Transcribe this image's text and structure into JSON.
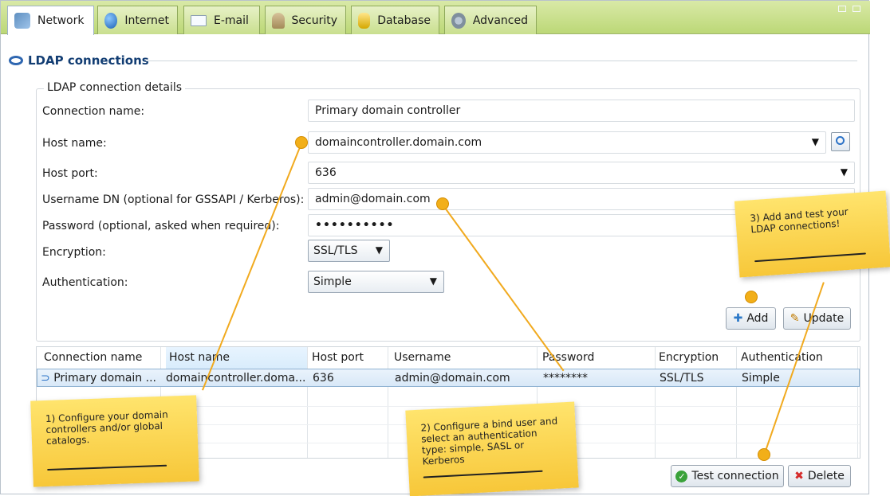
{
  "tabs": [
    {
      "label": "Network",
      "icon": "network-icon",
      "active": true
    },
    {
      "label": "Internet",
      "icon": "globe-icon",
      "active": false
    },
    {
      "label": "E-mail",
      "icon": "email-icon",
      "active": false
    },
    {
      "label": "Security",
      "icon": "security-icon",
      "active": false
    },
    {
      "label": "Database",
      "icon": "database-icon",
      "active": false
    },
    {
      "label": "Advanced",
      "icon": "gear-icon",
      "active": false
    }
  ],
  "section": {
    "title": "LDAP connections",
    "group_title": "LDAP connection details"
  },
  "form": {
    "connection_name": {
      "label": "Connection name:",
      "value": "Primary domain controller"
    },
    "host_name": {
      "label": "Host name:",
      "value": "domaincontroller.domain.com"
    },
    "host_port": {
      "label": "Host port:",
      "value": "636"
    },
    "username_dn": {
      "label": "Username DN (optional for GSSAPI / Kerberos):",
      "value": "admin@domain.com"
    },
    "password": {
      "label": "Password (optional, asked when required):",
      "value": "••••••••••"
    },
    "encryption": {
      "label": "Encryption:",
      "value": "SSL/TLS"
    },
    "authentication": {
      "label": "Authentication:",
      "value": "Simple"
    }
  },
  "buttons": {
    "add": "Add",
    "update": "Update",
    "test_connection": "Test connection",
    "delete": "Delete"
  },
  "table": {
    "headers": [
      "Connection name",
      "Host name",
      "Host port",
      "Username",
      "Password",
      "Encryption",
      "Authentication"
    ],
    "rows": [
      [
        "Primary domain ...",
        "domaincontroller.doma...",
        "636",
        "admin@domain.com",
        "********",
        "SSL/TLS",
        "Simple"
      ]
    ]
  },
  "notes": {
    "note1": "1) Configure your domain controllers and/or global catalogs.",
    "note2": "2) Configure a bind user and select an authentication type: simple, SASL or Kerberos",
    "note3": "3) Add and test your LDAP connections!"
  },
  "colors": {
    "tab_green": "#c9df8f",
    "note_yellow": "#f7c739",
    "accent_blue": "#123d73"
  }
}
